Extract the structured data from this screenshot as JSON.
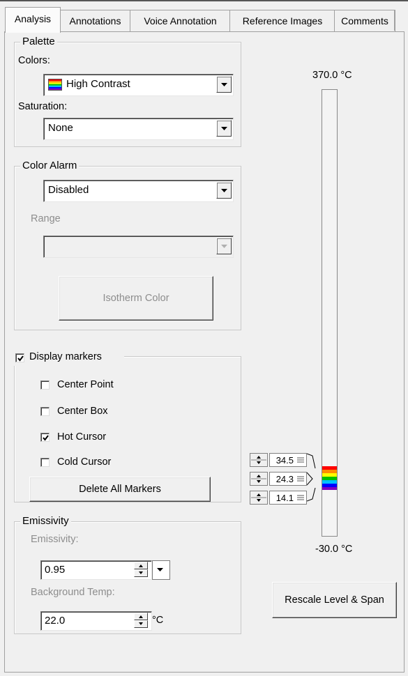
{
  "tabs": [
    "Analysis",
    "Annotations",
    "Voice Annotation",
    "Reference Images",
    "Comments"
  ],
  "palette": {
    "title": "Palette",
    "colors_label": "Colors:",
    "colors_value": "High Contrast",
    "saturation_label": "Saturation:",
    "saturation_value": "None"
  },
  "color_alarm": {
    "title": "Color Alarm",
    "mode_value": "Disabled",
    "range_label": "Range",
    "range_value": "",
    "isotherm_button": "Isotherm Color"
  },
  "markers": {
    "title": "Display markers",
    "title_checked": true,
    "items": [
      {
        "label": "Center Point",
        "checked": false
      },
      {
        "label": "Center Box",
        "checked": false
      },
      {
        "label": "Hot Cursor",
        "checked": true
      },
      {
        "label": "Cold Cursor",
        "checked": false
      }
    ],
    "delete_button": "Delete All Markers"
  },
  "emissivity": {
    "title": "Emissivity",
    "emissivity_label": "Emissivity:",
    "emissivity_value": "0.95",
    "bg_label": "Background Temp:",
    "bg_value": "22.0",
    "bg_unit": "°C"
  },
  "scale": {
    "max_label": "370.0 °C",
    "min_label": "-30.0 °C",
    "marker_values": [
      "34.5",
      "24.3",
      "14.1"
    ],
    "rescale_button": "Rescale Level & Span"
  },
  "colors": {
    "window_bg": "#f0f0f0",
    "check_mark": "#000000",
    "disabled_text": "#8d8d8d",
    "palette_gradient": [
      "#ff0000",
      "#ff8c00",
      "#ffff00",
      "#00c000",
      "#00c0ff",
      "#0000ff",
      "#8000c0"
    ]
  }
}
